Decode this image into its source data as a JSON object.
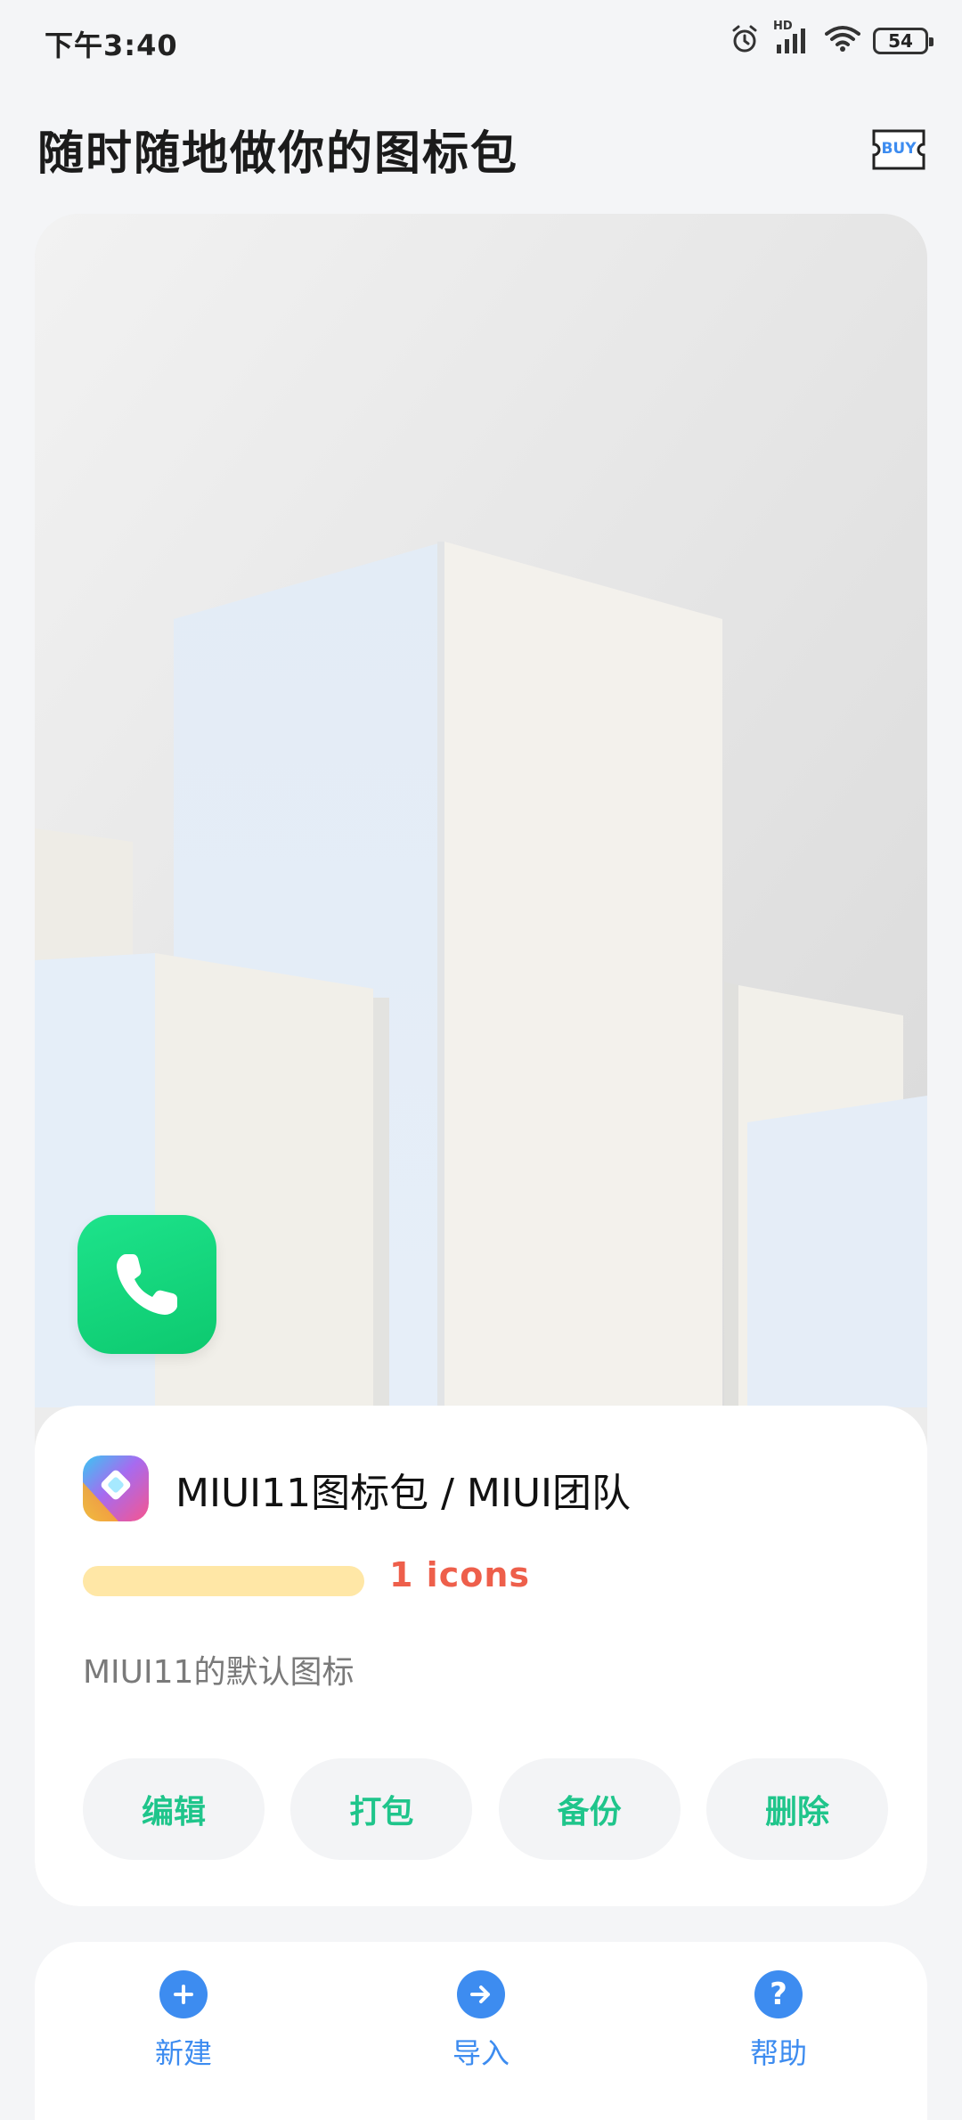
{
  "status_bar": {
    "time": "下午3:40",
    "battery_level": "54",
    "network_badge": "HD",
    "icons": [
      "alarm-icon",
      "signal-icon",
      "wifi-icon",
      "battery-icon"
    ]
  },
  "header": {
    "title": "随时随地做你的图标包",
    "buy_label": "BUY"
  },
  "icon_pack": {
    "title": "MIUI11图标包 / MIUI团队",
    "count_text": "1 icons",
    "description": "MIUI11的默认图标",
    "preview_icon": "phone-icon"
  },
  "actions": [
    {
      "label": "编辑"
    },
    {
      "label": "打包"
    },
    {
      "label": "备份"
    },
    {
      "label": "删除"
    }
  ],
  "bottom_nav": [
    {
      "label": "新建",
      "icon": "plus-icon"
    },
    {
      "label": "导入",
      "icon": "arrow-right-icon"
    },
    {
      "label": "帮助",
      "icon": "question-icon"
    }
  ],
  "colors": {
    "accent_green": "#1fc58b",
    "nav_blue": "#3d8cf0",
    "count_red": "#ee5f4b",
    "progress_yellow": "#ffe7a6"
  }
}
